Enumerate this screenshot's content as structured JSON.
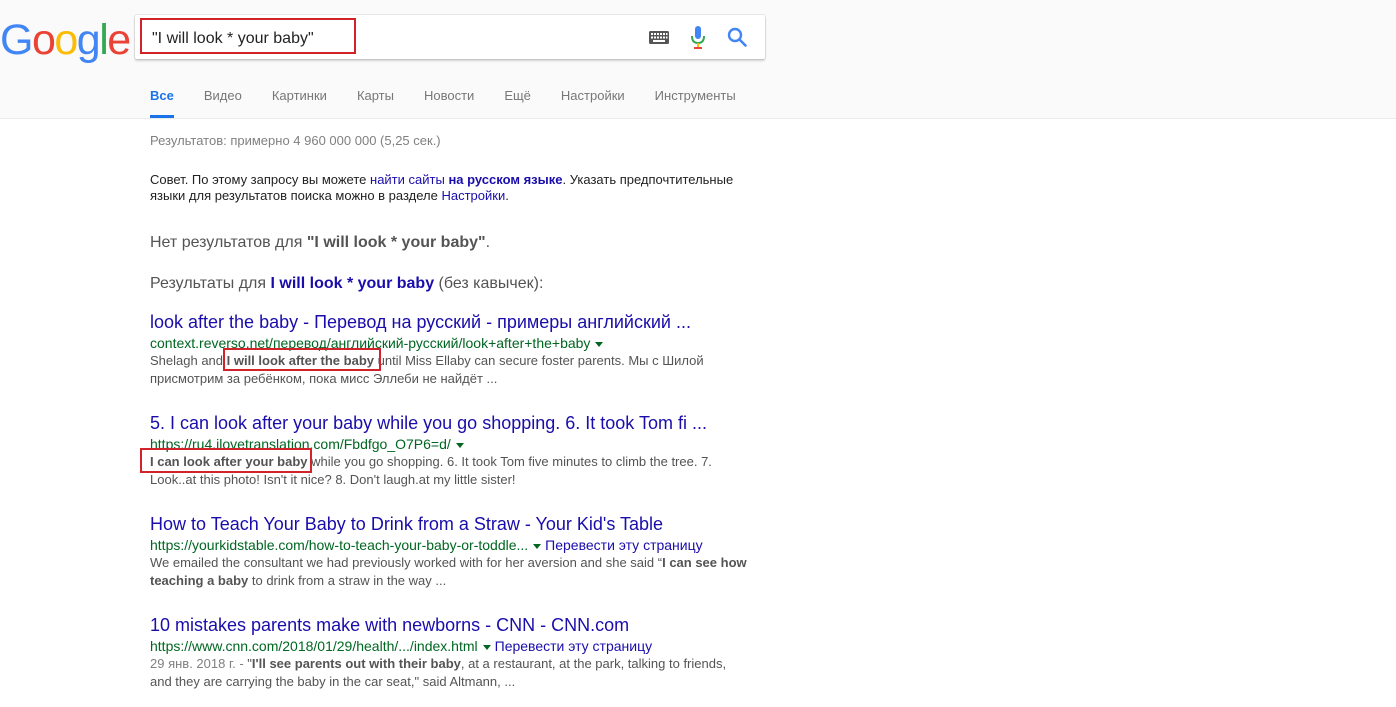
{
  "logo": {
    "letters": [
      "G",
      "o",
      "o",
      "g",
      "l",
      "e"
    ],
    "colors": [
      "#4285F4",
      "#EA4335",
      "#FBBC05",
      "#4285F4",
      "#34A853",
      "#EA4335"
    ]
  },
  "search": {
    "value": "\"I will look * your baby\""
  },
  "tabs": [
    {
      "label": "Все",
      "active": true
    },
    {
      "label": "Видео"
    },
    {
      "label": "Картинки"
    },
    {
      "label": "Карты"
    },
    {
      "label": "Новости"
    },
    {
      "label": "Ещё"
    },
    {
      "label": "Настройки"
    },
    {
      "label": "Инструменты"
    }
  ],
  "stats": "Результатов: примерно 4 960 000 000 (5,25 сек.)",
  "tip": {
    "prefix": "Совет. По этому запросу вы можете ",
    "link1": "найти сайты",
    "mid": " ",
    "link2": "на русском языке",
    "middle": ". Указать предпочтительные языки для результатов поиска можно в разделе ",
    "link3": "Настройки",
    "suffix": "."
  },
  "noresults": {
    "prefix": "Нет результатов для ",
    "query": "\"I will look * your baby\"",
    "suffix": "."
  },
  "showing": {
    "prefix": "Результаты для ",
    "query": "I will look * your baby",
    "suffix": " (без кавычек):"
  },
  "results": [
    {
      "title": "look after the baby - Перевод на русский - примеры английский ...",
      "url": "context.reverso.net/перевод/английский-русский/look+after+the+baby",
      "snippet_pre": "Shelagh and ",
      "snippet_bold": "I will look after the baby",
      "snippet_post": " until Miss Ellaby can secure foster parents. Мы с Шилой присмотрим за ребёнком, пока мисс Эллеби не найдёт ..."
    },
    {
      "title": "5. I can look after your baby while you go shopping. 6. It took Tom fi ...",
      "url": "https://ru4.ilovetranslation.com/Fbdfgo_O7P6=d/",
      "snippet_bold": "I can look after your baby",
      "snippet_post": " while you go shopping. 6. It took Tom five minutes to climb the tree. 7. Look..at this photo! Isn't it nice? 8. Don't laugh.at my little sister!"
    },
    {
      "title": "How to Teach Your Baby to Drink from a Straw - Your Kid's Table",
      "url": "https://yourkidstable.com/how-to-teach-your-baby-or-toddle...",
      "translate": "Перевести эту страницу",
      "snippet_pre": "We emailed the consultant we had previously worked with for her aversion and she said “",
      "snippet_bold": "I can see how teaching a baby",
      "snippet_post": " to drink from a straw in the way ..."
    },
    {
      "title": "10 mistakes parents make with newborns - CNN - CNN.com",
      "url": "https://www.cnn.com/2018/01/29/health/.../index.html",
      "translate": "Перевести эту страницу",
      "date": "29 янв. 2018 г. - ",
      "snippet_pre": "\"",
      "snippet_bold": "I'll see parents out with their baby",
      "snippet_post": ", at a restaurant, at the park, talking to friends, and they are carrying the baby in the car seat,\" said Altmann, ..."
    }
  ]
}
